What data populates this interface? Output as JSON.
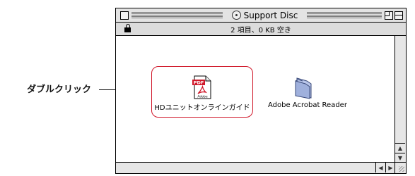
{
  "callout": {
    "text": "ダブルクリック"
  },
  "window": {
    "title": "Support Disc",
    "info": "2 項目、0 KB 空き"
  },
  "items": [
    {
      "label": "HDユニットオンラインガイド",
      "icon": "pdf-document-icon",
      "pdf_badge": "PDF",
      "brand": "Adobe"
    },
    {
      "label": "Adobe Acrobat Reader",
      "icon": "folder-icon"
    }
  ],
  "colors": {
    "highlight": "#d0182a",
    "pdf_badge": "#d0182a",
    "folder": "#9fb0dc"
  }
}
